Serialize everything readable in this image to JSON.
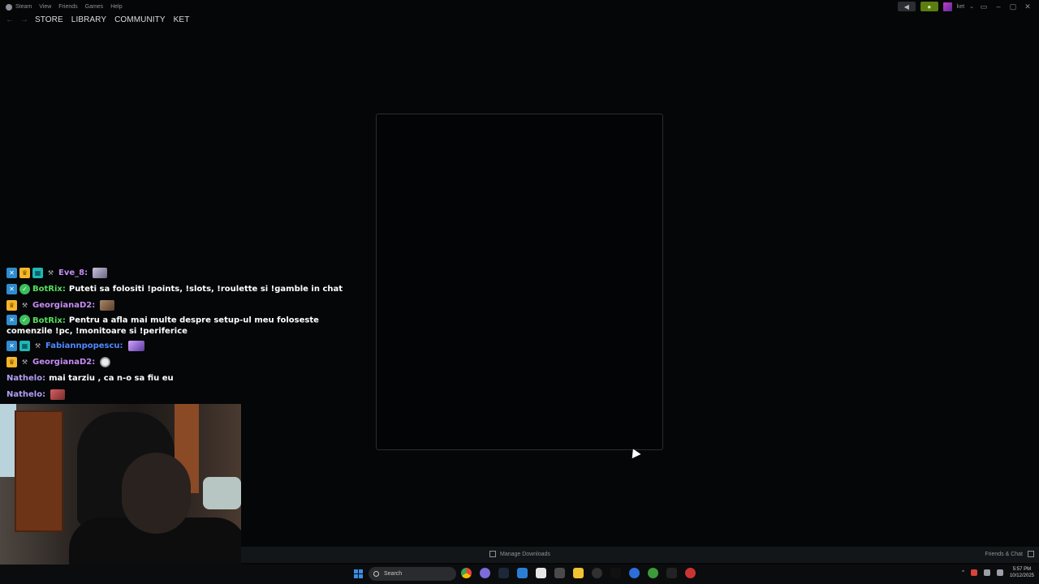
{
  "titlebar": {
    "menu": [
      "Steam",
      "View",
      "Friends",
      "Games",
      "Help"
    ],
    "user": "ket"
  },
  "nav": {
    "links": [
      "STORE",
      "LIBRARY",
      "COMMUNITY",
      "KET"
    ]
  },
  "chat": [
    {
      "name": "Eve_8:",
      "message": ""
    },
    {
      "name": "BotRix:",
      "message": "Puteti sa folositi !points, !slots, !roulette si !gamble in chat"
    },
    {
      "name": "GeorgianaD2:",
      "message": ""
    },
    {
      "name": "BotRix:",
      "message": "Pentru a afla mai multe despre setup-ul meu foloseste comenzile !pc, !monitoare si !periferice"
    },
    {
      "name": "Fabiannpopescu:",
      "message": ""
    },
    {
      "name": "GeorgianaD2:",
      "message": ""
    },
    {
      "name": "Nathelo:",
      "message": "mai tarziu , ca n-o sa fiu eu"
    },
    {
      "name": "Nathelo:",
      "message": ""
    }
  ],
  "bottombar": {
    "downloads": "Manage Downloads",
    "friends": "Friends & Chat"
  },
  "taskbar": {
    "search_placeholder": "Search",
    "time": "5:57 PM",
    "date": "10/12/2025"
  },
  "colors": {
    "accent_green": "#5c7e10",
    "chat_green": "#52e05b",
    "chat_purple": "#c58cf3",
    "chat_blue": "#4f89ff",
    "windows_blue": "#3a8ee6"
  }
}
